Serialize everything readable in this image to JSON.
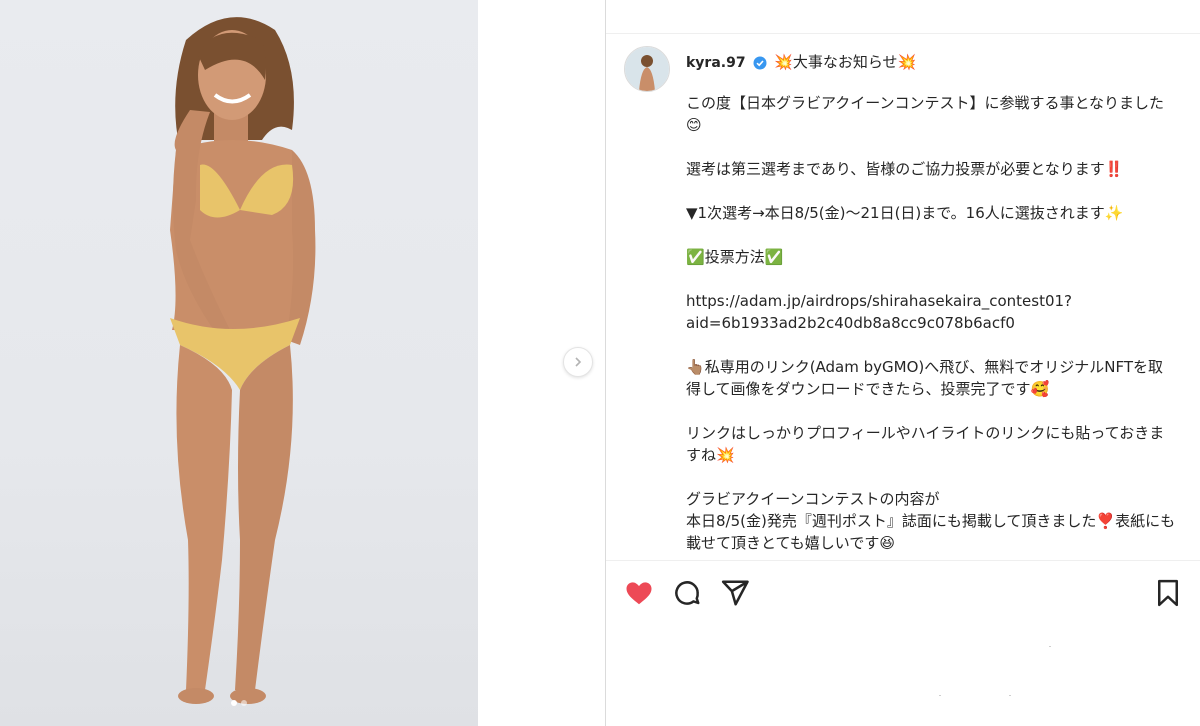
{
  "post": {
    "username": "kyra.97",
    "headline": "大事なお知らせ",
    "caption": {
      "p1": "この度【日本グラビアクイーンコンテスト】に参戦する事となりました",
      "p2": "選考は第三選考まであり、皆様のご協力投票が必要となります‼️",
      "p3": "▼1次選考→本日8/5(金)〜21日(日)まで。16人に選抜されます",
      "p4_label": "投票方法",
      "p5_url_line1": "https://adam.jp/airdrops/shirahasekaira_contest01?",
      "p5_url_line2": "aid=6b1933ad2b2c40db8a8cc9c078b6acf0",
      "p6": "私専用のリンク(Adam byGMO)へ飛び、無料でオリジナルNFTを取得して画像をダウンロードできたら、投票完了です",
      "p7": "リンクはしっかりプロフィールやハイライトのリンクにも貼っておきますね",
      "p8_line1": "グラビアクイーンコンテストの内容が",
      "p8_line2": "本日8/5(金)発売『週刊ポスト』誌面にも掲載して頂きました❣️表紙にも載せて頂きとても嬉しいです"
    },
    "media_slides": 2,
    "active_slide": 1,
    "liked": true
  },
  "icons": {
    "verified": "verified-badge-icon",
    "sparkle": "sparkle-emoji-icon",
    "smile": "smile-emoji-icon",
    "pointing": "point-up-emoji-icon",
    "heart": "heart-icon",
    "comment": "comment-icon",
    "share": "share-icon",
    "save": "bookmark-icon",
    "next": "chevron-right-icon"
  },
  "colors": {
    "like": "#ed4956",
    "verified": "#3897f0",
    "check": "#2db14b"
  }
}
